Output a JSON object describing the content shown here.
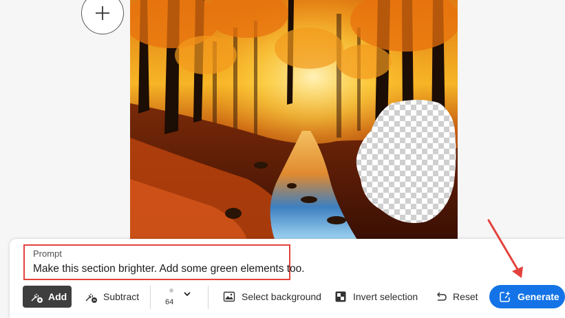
{
  "canvas": {
    "image_subject": "autumn forest stream",
    "add_icon": "plus-icon"
  },
  "prompt": {
    "label": "Prompt",
    "value": "Make this section brighter. Add some green elements too."
  },
  "toolbar": {
    "add_label": "Add",
    "subtract_label": "Subtract",
    "brush_size": "64",
    "select_background_label": "Select background",
    "invert_selection_label": "Invert selection",
    "reset_label": "Reset",
    "generate_label": "Generate"
  },
  "colors": {
    "accent": "#1473e6",
    "highlight_border": "#e3413b",
    "annotation_arrow": "#e3413b",
    "active_tool": "#3e3e3e"
  }
}
